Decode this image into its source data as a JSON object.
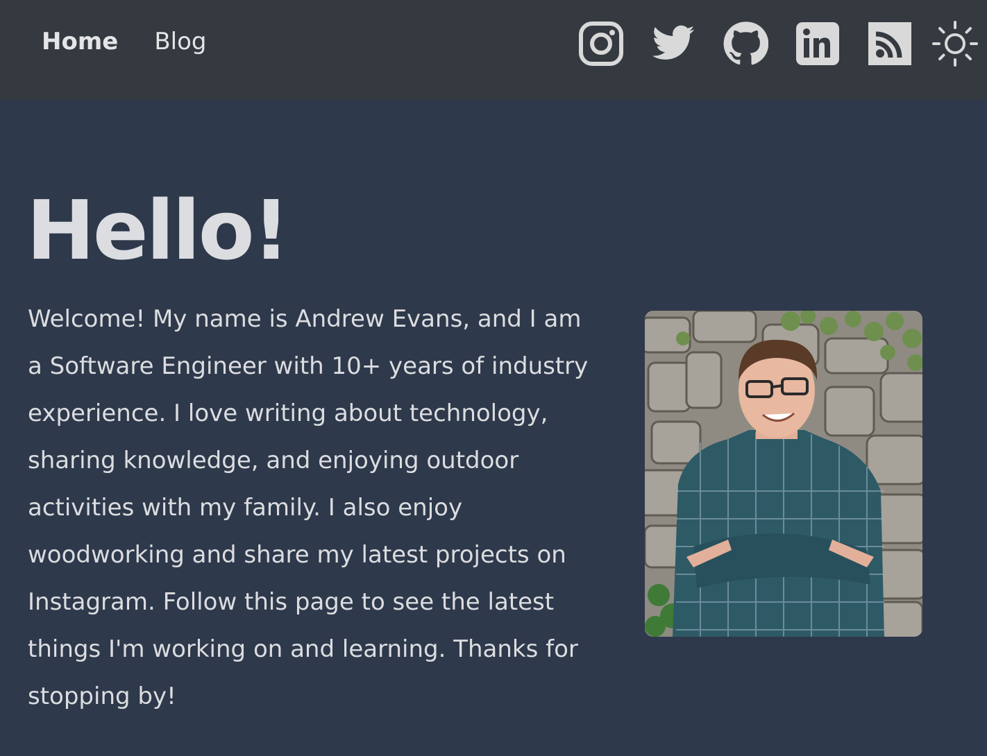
{
  "nav": {
    "items": [
      {
        "label": "Home",
        "active": true
      },
      {
        "label": "Blog",
        "active": false
      }
    ]
  },
  "social_icons": [
    {
      "icon": "instagram-icon"
    },
    {
      "icon": "twitter-icon"
    },
    {
      "icon": "github-icon"
    },
    {
      "icon": "linkedin-icon"
    },
    {
      "icon": "rss-icon"
    },
    {
      "icon": "sun-theme-toggle-icon"
    }
  ],
  "hero": {
    "heading": "Hello!",
    "intro": "Welcome! My name is Andrew Evans, and I am a Software Engineer with 10+ years of industry experience. I love writing about technology, sharing knowledge, and enjoying outdoor activities with my family. I also enjoy woodworking and share my latest projects on Instagram. Follow this page to see the latest things I'm working on and learning. Thanks for stopping by!"
  },
  "colors": {
    "topbar": "#343a40",
    "background": "#2e394b",
    "text": "#dcdde0",
    "icon": "#d9d9d9"
  }
}
